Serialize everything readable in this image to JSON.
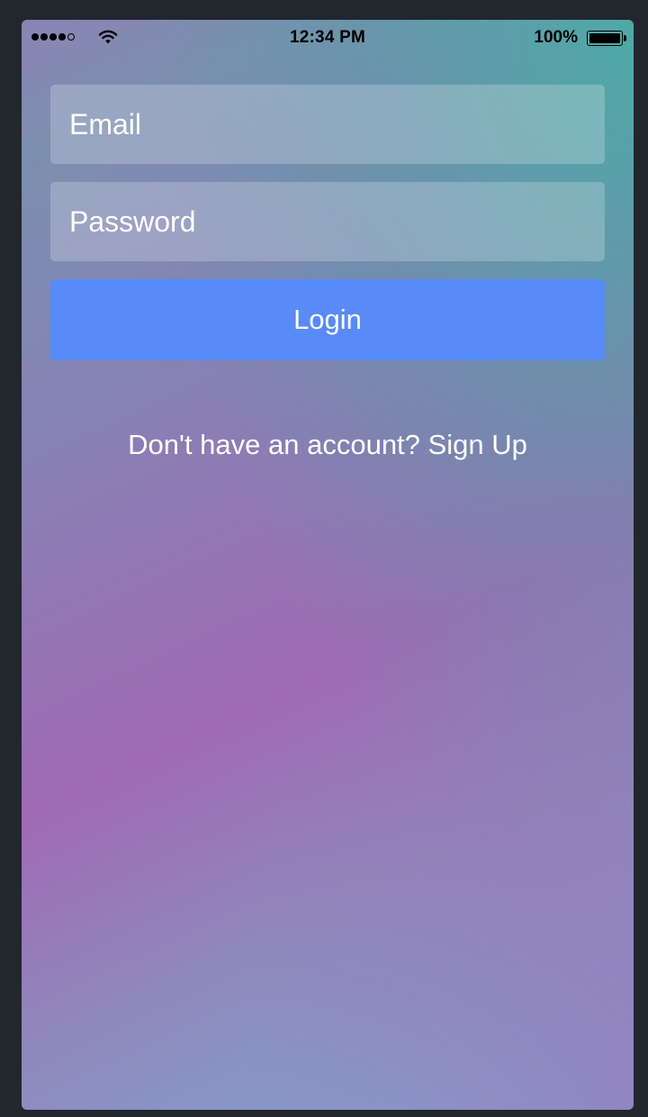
{
  "status_bar": {
    "time": "12:34 PM",
    "battery_percent": "100%",
    "signal_bars": 4,
    "signal_total": 5
  },
  "login_form": {
    "email_placeholder": "Email",
    "password_placeholder": "Password",
    "login_label": "Login",
    "signup_prompt": "Don't have an account?",
    "signup_link": "Sign Up"
  },
  "colors": {
    "login_button": "#588bf7",
    "text": "#ffffff"
  }
}
